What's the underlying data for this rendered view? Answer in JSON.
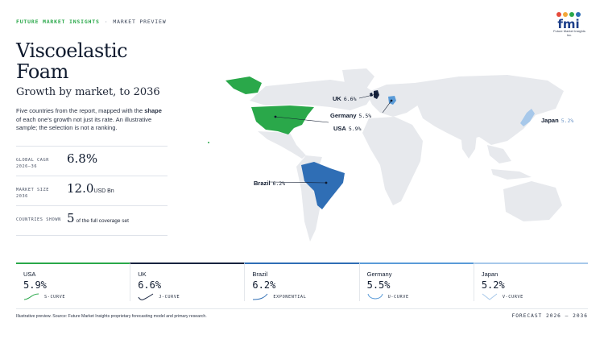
{
  "header": {
    "brand": "FUTURE MARKET INSIGHTS",
    "separator": "·",
    "section": "MARKET PREVIEW",
    "logo_text": "fmi",
    "logo_subtext": "Future Market Insights Inc."
  },
  "title_line1": "Viscoelastic",
  "title_line2": "Foam",
  "subtitle": "Growth by market, to 2036",
  "description": {
    "part1": "Five countries from the report, mapped with the ",
    "bold": "shape",
    "part2": " of each one's growth not just its rate. An illustrative sample; the selection is not a ranking."
  },
  "stats": [
    {
      "label": "GLOBAL CAGR 2026–36",
      "value": "6.8%",
      "unit": ""
    },
    {
      "label": "MARKET SIZE 2036",
      "value": "12.0",
      "unit": "USD Bn"
    },
    {
      "label": "COUNTRIES SHOWN",
      "value": "5",
      "unit": "of the full coverage set"
    }
  ],
  "map_labels": [
    {
      "name": "UK",
      "value": "6.6%"
    },
    {
      "name": "Germany",
      "value": "5.5%"
    },
    {
      "name": "USA",
      "value": "5.9%"
    },
    {
      "name": "Japan",
      "value": "5.2%"
    },
    {
      "name": "Brazil",
      "value": "6.2%"
    }
  ],
  "cards": [
    {
      "country": "USA",
      "value": "5.9%",
      "curve": "S-CURVE",
      "color": "#2aa84a"
    },
    {
      "country": "UK",
      "value": "6.6%",
      "curve": "J-CURVE",
      "color": "#17233f"
    },
    {
      "country": "Brazil",
      "value": "6.2%",
      "curve": "EXPONENTIAL",
      "color": "#2f6eb5"
    },
    {
      "country": "Germany",
      "value": "5.5%",
      "curve": "U-CURVE",
      "color": "#5a9bd8"
    },
    {
      "country": "Japan",
      "value": "5.2%",
      "curve": "V-CURVE",
      "color": "#a7c8ea"
    }
  ],
  "colors": {
    "usa": "#2aa84a",
    "uk": "#17233f",
    "brazil": "#2f6eb5",
    "germany": "#5a9bd8",
    "japan": "#a7c8ea",
    "land": "#e7e9ed"
  },
  "footer": {
    "note": "Illustrative preview. Source: Future Market Insights proprietary forecasting model and primary research.",
    "forecast": "FORECAST 2026 – 2036"
  }
}
